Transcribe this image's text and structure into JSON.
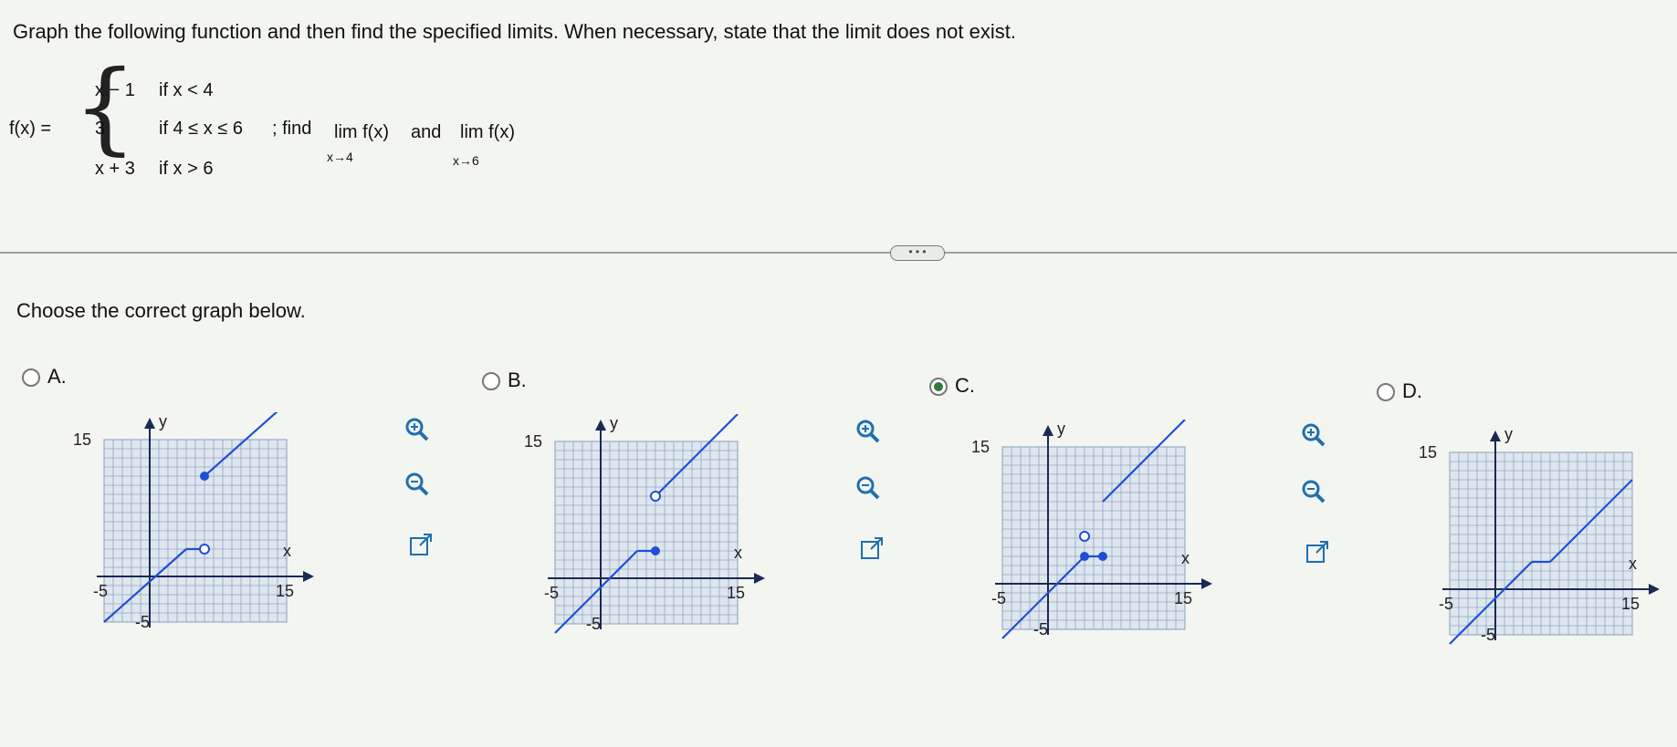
{
  "question": {
    "prompt": "Graph the following function and then find the specified limits. When necessary, state that the limit does not exist.",
    "function_label": "f(x) =",
    "cases": [
      {
        "expr": "x − 1",
        "cond": "if x < 4"
      },
      {
        "expr": "3",
        "cond": "if 4 ≤ x ≤ 6"
      },
      {
        "expr": "x + 3",
        "cond": "if x > 6"
      }
    ],
    "find_text": "; find",
    "limit1": {
      "lim": "lim f(x)",
      "sub": "x→4"
    },
    "and_text": "and",
    "limit2": {
      "lim": "lim f(x)",
      "sub": "x→6"
    }
  },
  "divider_handle": "• • •",
  "choose_text": "Choose the correct graph below.",
  "options": [
    {
      "label": "A.",
      "selected": false
    },
    {
      "label": "B.",
      "selected": false
    },
    {
      "label": "C.",
      "selected": true
    },
    {
      "label": "D.",
      "selected": false
    }
  ],
  "graph_axis": {
    "y_label": "y",
    "x_label": "x",
    "y_top": "15",
    "y_bottom": "-5",
    "x_left": "-5",
    "x_right": "15"
  },
  "tools": [
    "zoom-in-icon",
    "zoom-out-icon",
    "open-new-window-icon"
  ],
  "colors": {
    "line": "#1f4fd6",
    "grid": "#8fa8c4",
    "selected_radio": "#2f7a3a"
  }
}
